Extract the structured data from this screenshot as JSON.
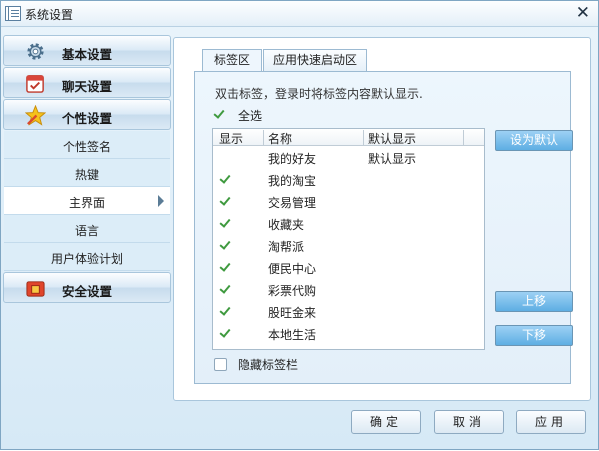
{
  "window": {
    "title": "系统设置"
  },
  "sidebar": {
    "categories": {
      "basic": "基本设置",
      "chat": "聊天设置",
      "personal": "个性设置",
      "security": "安全设置"
    },
    "sub_items": [
      "个性签名",
      "热键",
      "主界面",
      "语言",
      "用户体验计划"
    ],
    "active_sub": "主界面"
  },
  "tabs": [
    "标签区",
    "应用快速启动区"
  ],
  "active_tab": "标签区",
  "hint": "双击标签，登录时将标签内容默认显示.",
  "select_all": {
    "label": "全选",
    "checked": true
  },
  "table": {
    "headers": [
      "显示",
      "名称",
      "默认显示"
    ],
    "rows": [
      {
        "checked": false,
        "name": "我的好友",
        "default": "默认显示"
      },
      {
        "checked": true,
        "name": "我的淘宝",
        "default": ""
      },
      {
        "checked": true,
        "name": "交易管理",
        "default": ""
      },
      {
        "checked": true,
        "name": "收藏夹",
        "default": ""
      },
      {
        "checked": true,
        "name": "淘帮派",
        "default": ""
      },
      {
        "checked": true,
        "name": "便民中心",
        "default": ""
      },
      {
        "checked": true,
        "name": "彩票代购",
        "default": ""
      },
      {
        "checked": true,
        "name": "股旺金来",
        "default": ""
      },
      {
        "checked": true,
        "name": "本地生活",
        "default": ""
      }
    ]
  },
  "side_buttons": {
    "set_default": "设为默认",
    "move_up": "上移",
    "move_down": "下移"
  },
  "hide_tabs": {
    "label": "隐藏标签栏",
    "checked": false
  },
  "footer": {
    "ok": "确定",
    "cancel": "取消",
    "apply": "应用"
  },
  "colors": {
    "accent_button": "#5eaee3",
    "check": "#3f9a3f",
    "panel_bg": "#e3eff9"
  }
}
